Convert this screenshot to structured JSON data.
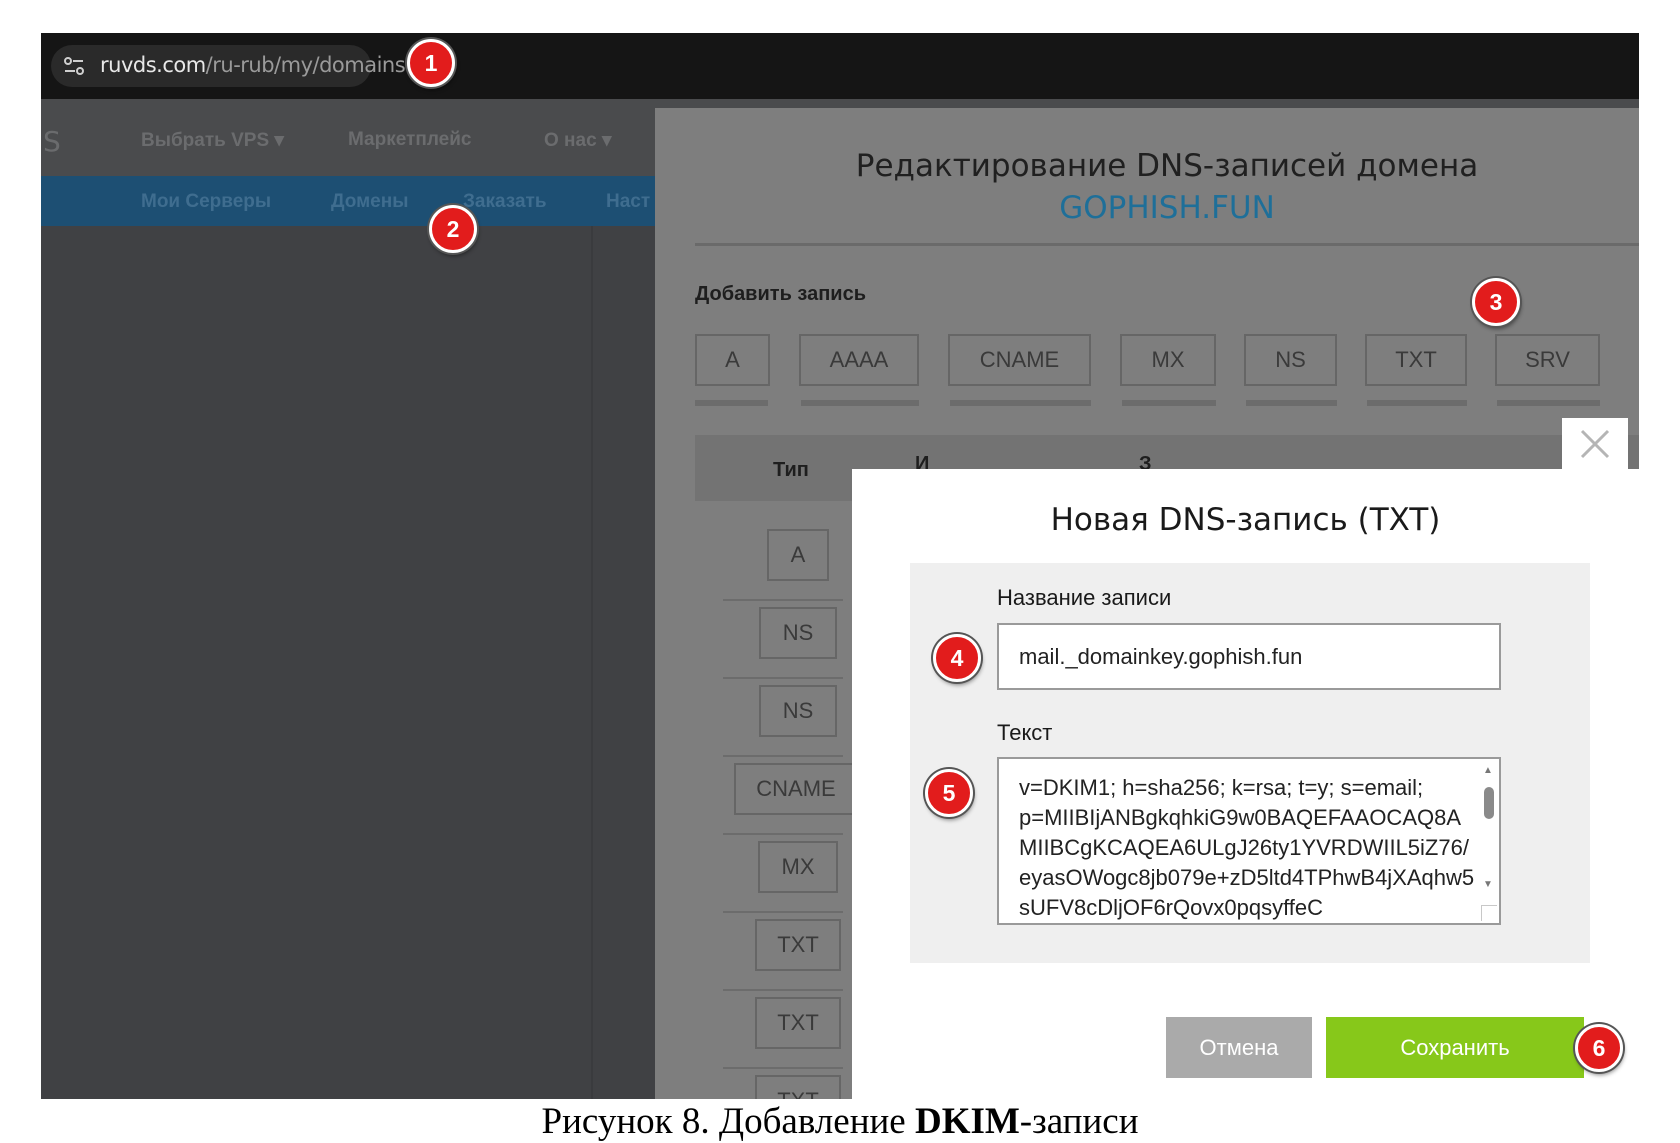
{
  "browser": {
    "url_domain": "ruvds.com",
    "url_path": "/ru-rub/my/domains"
  },
  "site_nav": {
    "logo_fragment": "S",
    "top_items": [
      "Выбрать VPS ▾",
      "Маркетплейс",
      "О нас ▾"
    ],
    "sub_items": [
      "Мои Серверы",
      "Домены",
      "Заказать",
      "Наст"
    ]
  },
  "dns_panel": {
    "title": "Редактирование DNS-записей домена",
    "domain": "GOPHISH.FUN",
    "add_record_label": "Добавить запись",
    "record_types": [
      "A",
      "AAAA",
      "CNAME",
      "MX",
      "NS",
      "TXT",
      "SRV"
    ],
    "table_header_type": "Тип",
    "table_header_fragments": [
      "И",
      "З"
    ],
    "rows": [
      "A",
      "NS",
      "NS",
      "CNAME",
      "MX",
      "TXT",
      "TXT",
      "TXT"
    ]
  },
  "modal": {
    "title": "Новая DNS-запись (TXT)",
    "name_label": "Название записи",
    "name_value": "mail._domainkey.gophish.fun",
    "text_label": "Текст",
    "text_value": "v=DKIM1; h=sha256; k=rsa; t=y; s=email; p=MIIBIjANBgkqhkiG9w0BAQEFAAOCAQ8AMIIBCgKCAQEA6ULgJ26ty1YVRDWIIL5iZ76/eyasOWogc8jb079e+zD5ltd4TPhwB4jXAqhw5sUFV8cDljOF6rQovx0pqsyffeC",
    "cancel_label": "Отмена",
    "save_label": "Сохранить",
    "close_symbol": "✕"
  },
  "markers": [
    "1",
    "2",
    "3",
    "4",
    "5",
    "6"
  ],
  "caption": {
    "prefix": "Рисунок 8. Добавление ",
    "bold": "DKIM",
    "suffix": "-записи"
  },
  "colors": {
    "accent_green": "#87c81a",
    "marker_red": "#e21c1c",
    "domain_blue": "#1e6f99",
    "subnav_blue": "#1d4f73"
  },
  "icons": {
    "site_settings": "site-settings-icon",
    "close": "close-icon",
    "scroll_up": "scroll-up-arrow-icon",
    "scroll_down": "scroll-down-arrow-icon"
  }
}
